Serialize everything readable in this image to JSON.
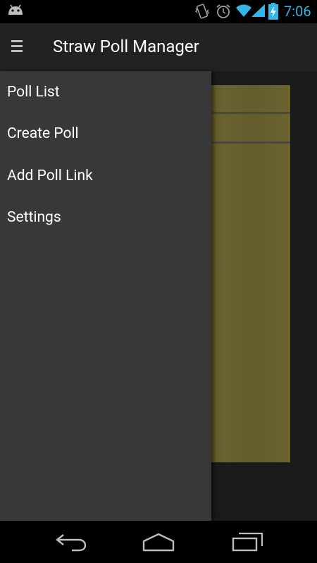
{
  "status_bar": {
    "time": "7:06",
    "icons": [
      "android-icon",
      "vibrate-icon",
      "alarm-icon",
      "wifi-icon",
      "signal-icon",
      "battery-charging-icon"
    ]
  },
  "action_bar": {
    "title": "Straw Poll Manager",
    "drawer_icon": "drawer-indicator-icon"
  },
  "drawer": {
    "items": [
      {
        "label": "Poll List"
      },
      {
        "label": "Create Poll"
      },
      {
        "label": "Add Poll Link"
      },
      {
        "label": "Settings"
      }
    ]
  },
  "navigation_bar": {
    "buttons": [
      "back-icon",
      "home-icon",
      "recent-apps-icon"
    ]
  },
  "colors": {
    "clock": "#33b5e5",
    "action_bar": "#222222",
    "drawer": "#383838",
    "poll_card": "#675f2e"
  }
}
